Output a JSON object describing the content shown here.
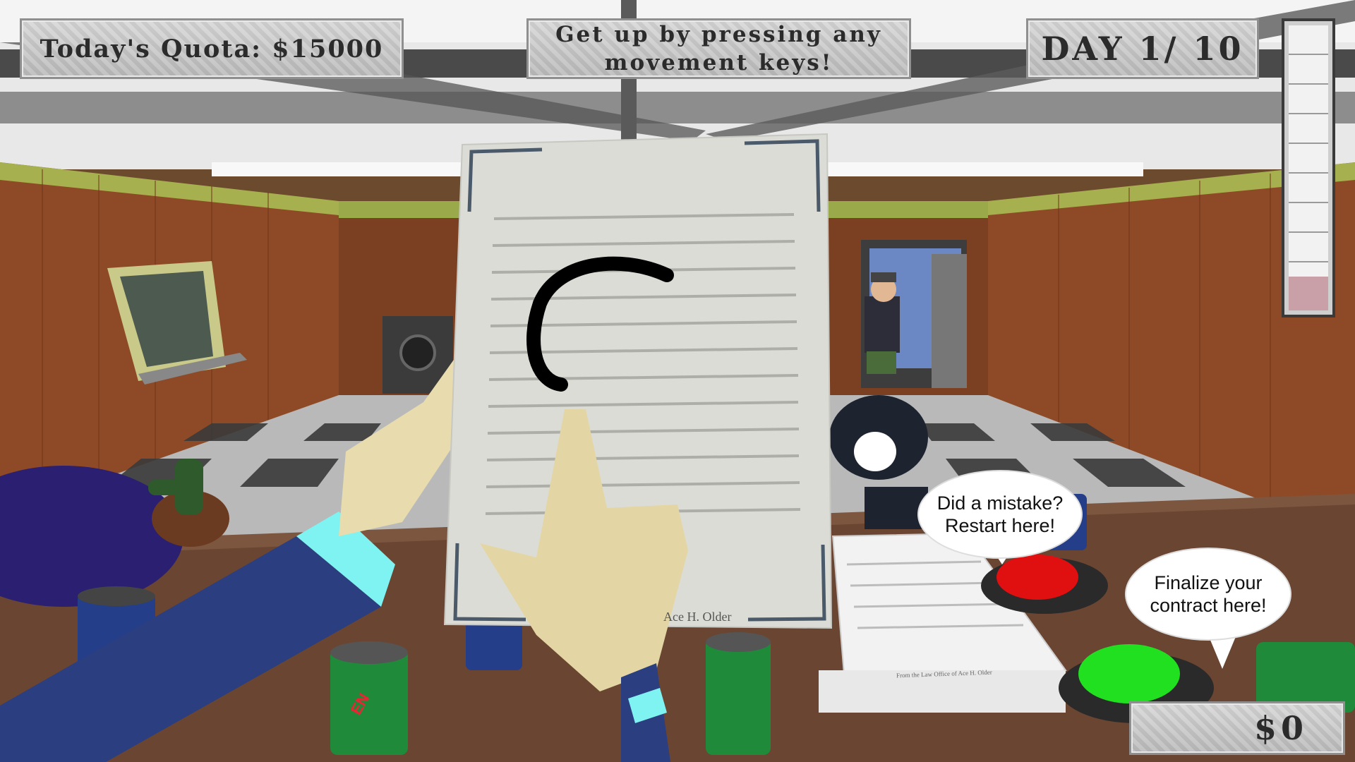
{
  "hud": {
    "quota": "Today's Quota: $15000",
    "hint": "Get up by pressing any movement keys!",
    "day": "DAY 1/ 10",
    "money": "$0"
  },
  "contract": {
    "footer_name": "Ace H. Older",
    "stack_footer": "From the Law Office of Ace H. Older"
  },
  "cans": {
    "green_label": "EN"
  },
  "tooltips": {
    "restart": "Did a mistake?\nRestart here!",
    "finalize": "Finalize your\ncontract here!"
  },
  "colors": {
    "restart_button": "#e01010",
    "finalize_button": "#20e020",
    "wall": "#8a4a2a",
    "floor_dark": "#3a3a3a"
  }
}
